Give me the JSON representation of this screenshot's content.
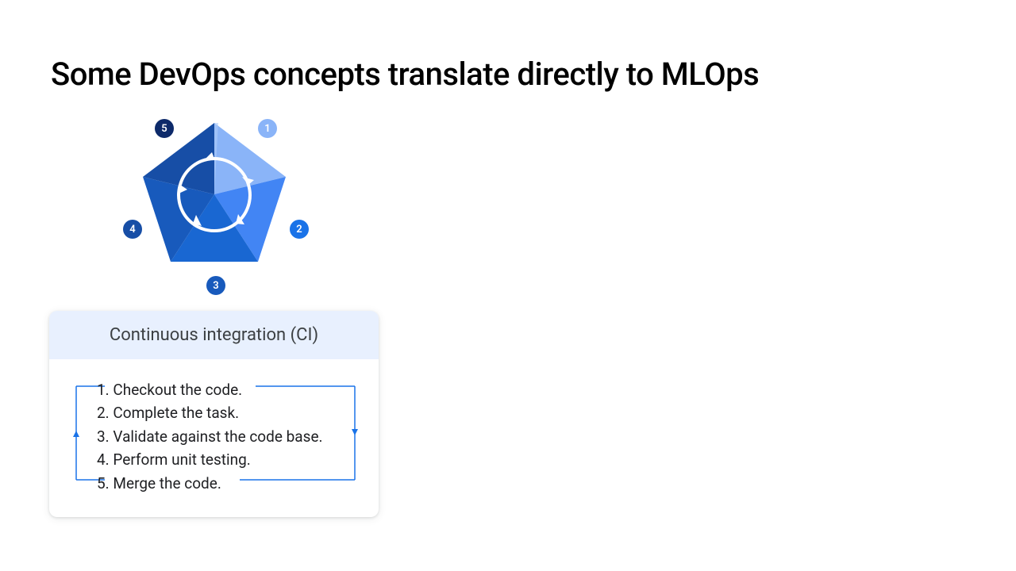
{
  "title": "Some DevOps concepts translate directly to MLOps",
  "pentagon": {
    "badges": {
      "b1": "1",
      "b2": "2",
      "b3": "3",
      "b4": "4",
      "b5": "5"
    }
  },
  "card": {
    "header": "Continuous integration (CI)",
    "steps": {
      "s1": "1. Checkout the code.",
      "s2": "2. Complete the task.",
      "s3": "3. Validate against the code base.",
      "s4": "4. Perform unit testing.",
      "s5": "5. Merge the code."
    }
  }
}
